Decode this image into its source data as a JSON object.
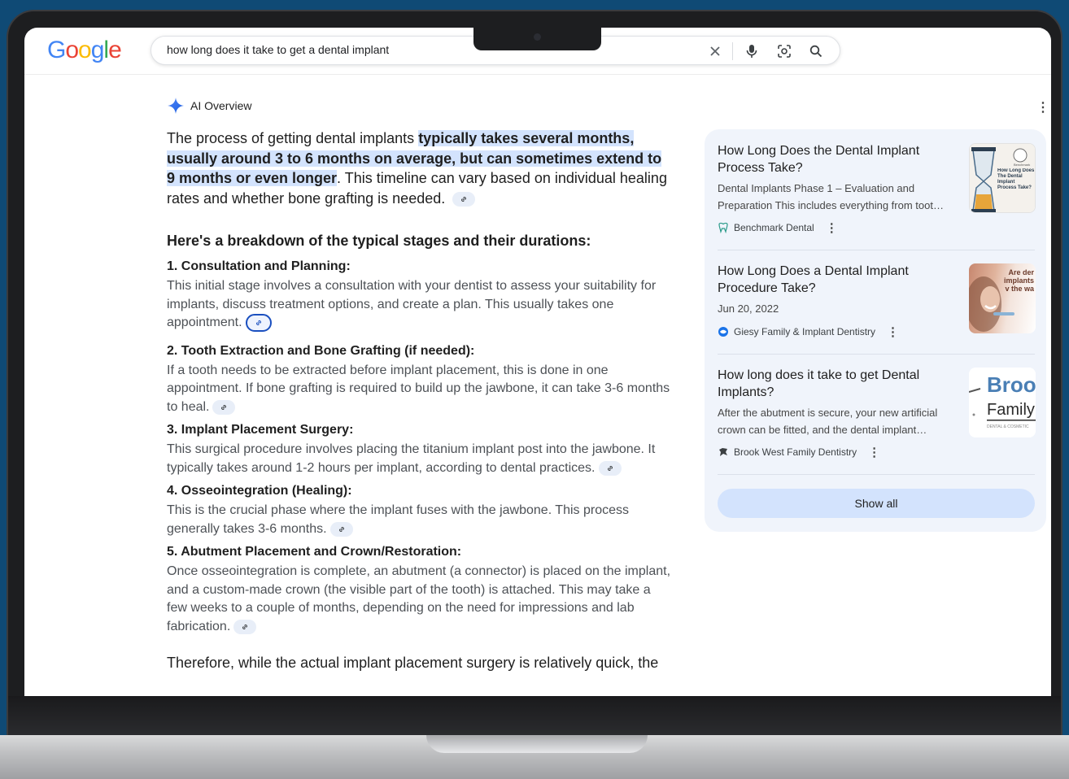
{
  "search": {
    "logo_text": "Google",
    "query": "how long does it take to get a dental implant"
  },
  "ai_overview": {
    "label": "AI Overview",
    "intro_plain_1": "The process of getting dental implants ",
    "intro_highlight": "typically takes several months, usually around 3 to 6 months on average, but can sometimes extend to 9 months or even longer",
    "intro_plain_2": ". This timeline can vary based on individual healing rates and whether bone grafting is needed.",
    "breakdown_heading": "Here's a breakdown of the typical stages and their durations:",
    "steps": [
      {
        "title": "1. Consultation and Planning:",
        "body": "This initial stage involves a consultation with your dentist to assess your suitability for implants, discuss treatment options, and create a plan. This usually takes one appointment."
      },
      {
        "title": "2. Tooth Extraction and Bone Grafting (if needed):",
        "body": "If a tooth needs to be extracted before implant placement, this is done in one appointment. If bone grafting is required to build up the jawbone, it can take 3-6 months to heal."
      },
      {
        "title": "3. Implant Placement Surgery:",
        "body": "This surgical procedure involves placing the titanium implant post into the jawbone. It typically takes around 1-2 hours per implant, according to dental practices."
      },
      {
        "title": "4. Osseointegration (Healing):",
        "body": "This is the crucial phase where the implant fuses with the jawbone. This process generally takes 3-6 months."
      },
      {
        "title": "5. Abutment Placement and Crown/Restoration:",
        "body": "Once osseointegration is complete, an abutment (a connector) is placed on the implant, and a custom-made crown (the visible part of the tooth) is attached. This may take a few weeks to a couple of months, depending on the need for impressions and lab fabrication."
      }
    ],
    "outro": "Therefore, while the actual implant placement surgery is relatively quick, the"
  },
  "sources": {
    "cards": [
      {
        "title": "How Long Does the Dental Implant Process Take?",
        "snippet": "Dental Implants Phase 1 – Evaluation and Preparation This includes everything from toot…",
        "source": "Benchmark Dental",
        "thumb_text": "How Long Does The Dental Implant Process Take?",
        "thumb_logo": "Benchmark"
      },
      {
        "title": "How Long Does a Dental Implant Procedure Take?",
        "snippet": "Jun 20, 2022",
        "source": "Giesy Family & Implant Dentistry",
        "thumb_text": "Are der implants v the wa"
      },
      {
        "title": "How long does it take to get Dental Implants?",
        "snippet": "After the abutment is secure, your new artificial crown can be fitted, and the dental implant…",
        "source": "Brook West Family Dentistry",
        "thumb_line1": "Broo",
        "thumb_line2": "Family",
        "thumb_line3": "DENTAL & COSMETIC"
      }
    ],
    "show_all": "Show all"
  },
  "colors": {
    "background": "#0f4a75",
    "highlight": "#d3e3fd",
    "panel": "#f0f4fb",
    "google_blue": "#4285f4",
    "google_red": "#ea4335",
    "google_yellow": "#fbbc05",
    "google_green": "#34a853"
  },
  "icons": {
    "clear": "close-icon",
    "voice": "mic-icon",
    "lens": "lens-icon",
    "search": "search-icon",
    "ai": "sparkle-icon",
    "link": "link-icon"
  }
}
